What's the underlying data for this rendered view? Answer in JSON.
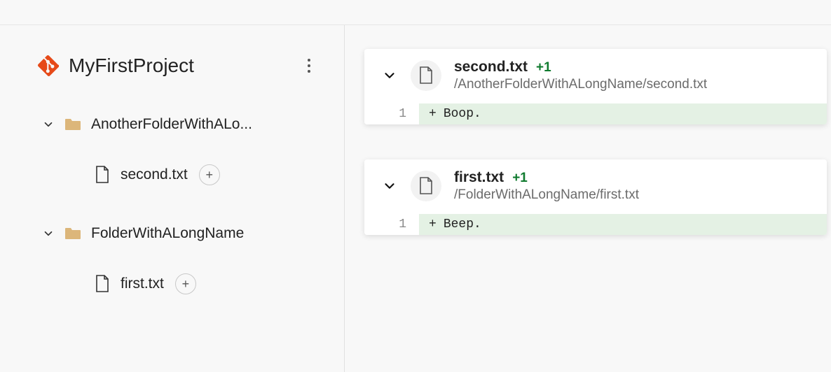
{
  "project": {
    "title": "MyFirstProject"
  },
  "tree": {
    "folders": [
      {
        "label": "AnotherFolderWithALo...",
        "files": [
          {
            "label": "second.txt",
            "badge": "+"
          }
        ]
      },
      {
        "label": "FolderWithALongName",
        "files": [
          {
            "label": "first.txt",
            "badge": "+"
          }
        ]
      }
    ]
  },
  "diffs": [
    {
      "filename": "second.txt",
      "delta": "+1",
      "path": "/AnotherFolderWithALongName/second.txt",
      "lines": [
        {
          "no": "1",
          "prefix": "+",
          "text": "Boop."
        }
      ]
    },
    {
      "filename": "first.txt",
      "delta": "+1",
      "path": "/FolderWithALongName/first.txt",
      "lines": [
        {
          "no": "1",
          "prefix": "+",
          "text": "Beep."
        }
      ]
    }
  ]
}
